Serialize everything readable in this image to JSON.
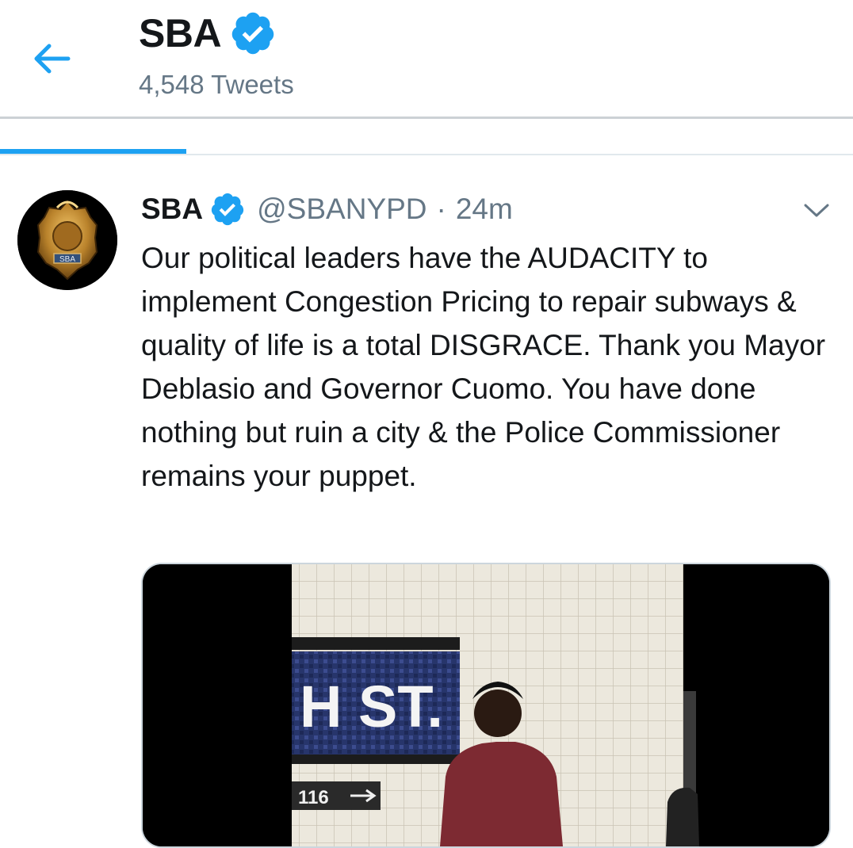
{
  "header": {
    "title": "SBA",
    "tweet_count": "4,548 Tweets",
    "back_icon": "arrow-left-icon",
    "verified_icon": "verified-badge-icon"
  },
  "colors": {
    "accent": "#1da1f2",
    "text": "#14171a",
    "secondary": "#657786"
  },
  "tweet": {
    "name": "SBA",
    "handle": "@SBANYPD",
    "separator": "·",
    "time": "24m",
    "text": "Our political leaders have the AUDACITY to implement Congestion Pricing to repair subways & quality of life is a total DISGRACE. Thank you Mayor Deblasio and Governor Cuomo. You have done nothing but ruin a city & the Police Commissioner remains your puppet.",
    "avatar_badge_text": "SBA",
    "menu_icon": "chevron-down-icon",
    "media": {
      "sign_text": "H ST.",
      "arrow_sign_text": "116"
    }
  }
}
